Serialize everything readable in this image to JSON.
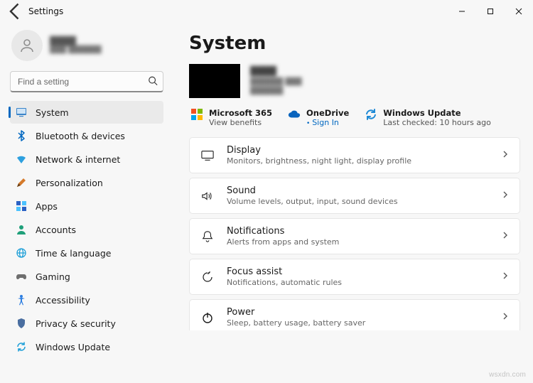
{
  "window": {
    "title": "Settings"
  },
  "account": {
    "name": "████",
    "sub": "███ ██████"
  },
  "search": {
    "placeholder": "Find a setting"
  },
  "sidebar": {
    "items": [
      {
        "label": "System"
      },
      {
        "label": "Bluetooth & devices"
      },
      {
        "label": "Network & internet"
      },
      {
        "label": "Personalization"
      },
      {
        "label": "Apps"
      },
      {
        "label": "Accounts"
      },
      {
        "label": "Time & language"
      },
      {
        "label": "Gaming"
      },
      {
        "label": "Accessibility"
      },
      {
        "label": "Privacy & security"
      },
      {
        "label": "Windows Update"
      }
    ]
  },
  "page": {
    "title": "System",
    "device": {
      "name": "████",
      "line2": "██████ ███",
      "line3": "██████"
    },
    "services": {
      "ms365": {
        "title": "Microsoft 365",
        "sub": "View benefits"
      },
      "onedrive": {
        "title": "OneDrive",
        "sub": "Sign In"
      },
      "wu": {
        "title": "Windows Update",
        "sub": "Last checked: 10 hours ago"
      }
    },
    "cards": [
      {
        "title": "Display",
        "sub": "Monitors, brightness, night light, display profile"
      },
      {
        "title": "Sound",
        "sub": "Volume levels, output, input, sound devices"
      },
      {
        "title": "Notifications",
        "sub": "Alerts from apps and system"
      },
      {
        "title": "Focus assist",
        "sub": "Notifications, automatic rules"
      },
      {
        "title": "Power",
        "sub": "Sleep, battery usage, battery saver"
      }
    ]
  },
  "watermark": "wsxdn.com"
}
